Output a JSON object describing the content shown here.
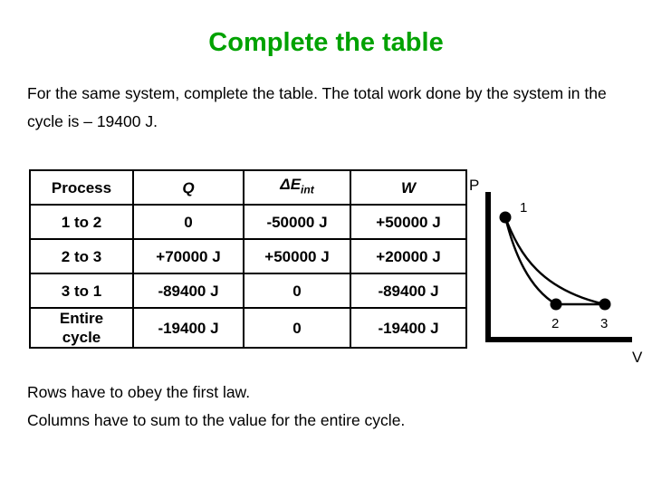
{
  "slide": {
    "title": "Complete the table",
    "title_color": "#00a200",
    "intro": "For the same system, complete the table. The total work done by the system in the cycle is – 19400 J.",
    "footer_line1": "Rows have to obey the first law.",
    "footer_line2": "Columns have to sum to the value for the entire cycle.",
    "highlight_color": "#cc0000"
  },
  "table": {
    "headers": {
      "process": "Process",
      "q": "Q",
      "delta_e": "ΔE",
      "delta_e_sub": "int",
      "w": "W"
    },
    "rows": [
      {
        "process": "1 to 2",
        "q": "0",
        "q_red": false,
        "delta_e": "-50000 J",
        "delta_e_red": false,
        "w": "+50000 J",
        "w_red": true
      },
      {
        "process": "2 to 3",
        "q": "+70000 J",
        "q_red": false,
        "delta_e": "+50000 J",
        "delta_e_red": false,
        "w": "+20000 J",
        "w_red": false
      },
      {
        "process": "3 to 1",
        "q": "-89400 J",
        "q_red": true,
        "delta_e": "0",
        "delta_e_red": false,
        "w": "-89400 J",
        "w_red": true
      },
      {
        "process_line1": "Entire",
        "process_line2": "cycle",
        "q": "-19400 J",
        "q_red": false,
        "delta_e": "0",
        "delta_e_red": false,
        "w": "-19400 J",
        "w_red": false
      }
    ]
  },
  "pv_diagram": {
    "y_axis_label": "P",
    "x_axis_label": "V",
    "point_labels": [
      "1",
      "2",
      "3"
    ],
    "points": [
      {
        "label": "1",
        "x": 46,
        "y": 50
      },
      {
        "label": "2",
        "x": 102,
        "y": 146
      },
      {
        "label": "3",
        "x": 156,
        "y": 146
      }
    ],
    "paths": {
      "curve_1_to_2": "isotherm-inner",
      "curve_1_to_3": "isotherm-outer",
      "line_2_to_3": "isobar"
    }
  },
  "chart_data": {
    "type": "line",
    "title": "",
    "xlabel": "V",
    "ylabel": "P",
    "grid": false,
    "legend": "none",
    "annotations": [
      "1",
      "2",
      "3"
    ],
    "series": [
      {
        "name": "1 to 2 (inner curve)",
        "x": [
          46,
          54,
          64,
          76,
          88,
          96,
          102
        ],
        "y": [
          50,
          72,
          96,
          118,
          134,
          142,
          146
        ]
      },
      {
        "name": "1 to 3 (outer curve)",
        "x": [
          46,
          58,
          74,
          94,
          116,
          138,
          156
        ],
        "y": [
          50,
          76,
          102,
          122,
          135,
          143,
          146
        ]
      },
      {
        "name": "2 to 3 (straight line)",
        "x": [
          102,
          156
        ],
        "y": [
          146,
          146
        ]
      }
    ]
  }
}
